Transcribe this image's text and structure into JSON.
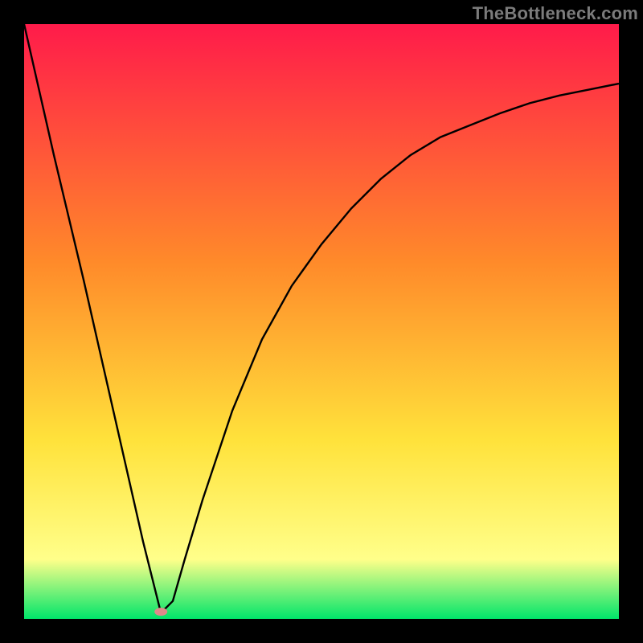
{
  "watermark": "TheBottleneck.com",
  "chart_data": {
    "type": "line",
    "title": "",
    "xlabel": "",
    "ylabel": "",
    "xlim": [
      0,
      100
    ],
    "ylim": [
      0,
      100
    ],
    "grid": false,
    "legend": false,
    "background_gradient": {
      "top": "#ff1b4a",
      "mid1": "#ff8a2a",
      "mid2": "#ffe23b",
      "band": "#ffff8a",
      "bottom": "#00e56a"
    },
    "series": [
      {
        "name": "bottleneck-curve",
        "x": [
          0,
          5,
          10,
          15,
          20,
          23,
          25,
          27,
          30,
          35,
          40,
          45,
          50,
          55,
          60,
          65,
          70,
          75,
          80,
          85,
          90,
          95,
          100
        ],
        "y": [
          100,
          78,
          57,
          35,
          13,
          1,
          3,
          10,
          20,
          35,
          47,
          56,
          63,
          69,
          74,
          78,
          81,
          83,
          85,
          86.7,
          88,
          89,
          90
        ]
      }
    ],
    "marker": {
      "name": "optimal-point",
      "x": 23,
      "y": 1.2,
      "color": "#e08a8a",
      "rx": 8,
      "ry": 5
    }
  }
}
